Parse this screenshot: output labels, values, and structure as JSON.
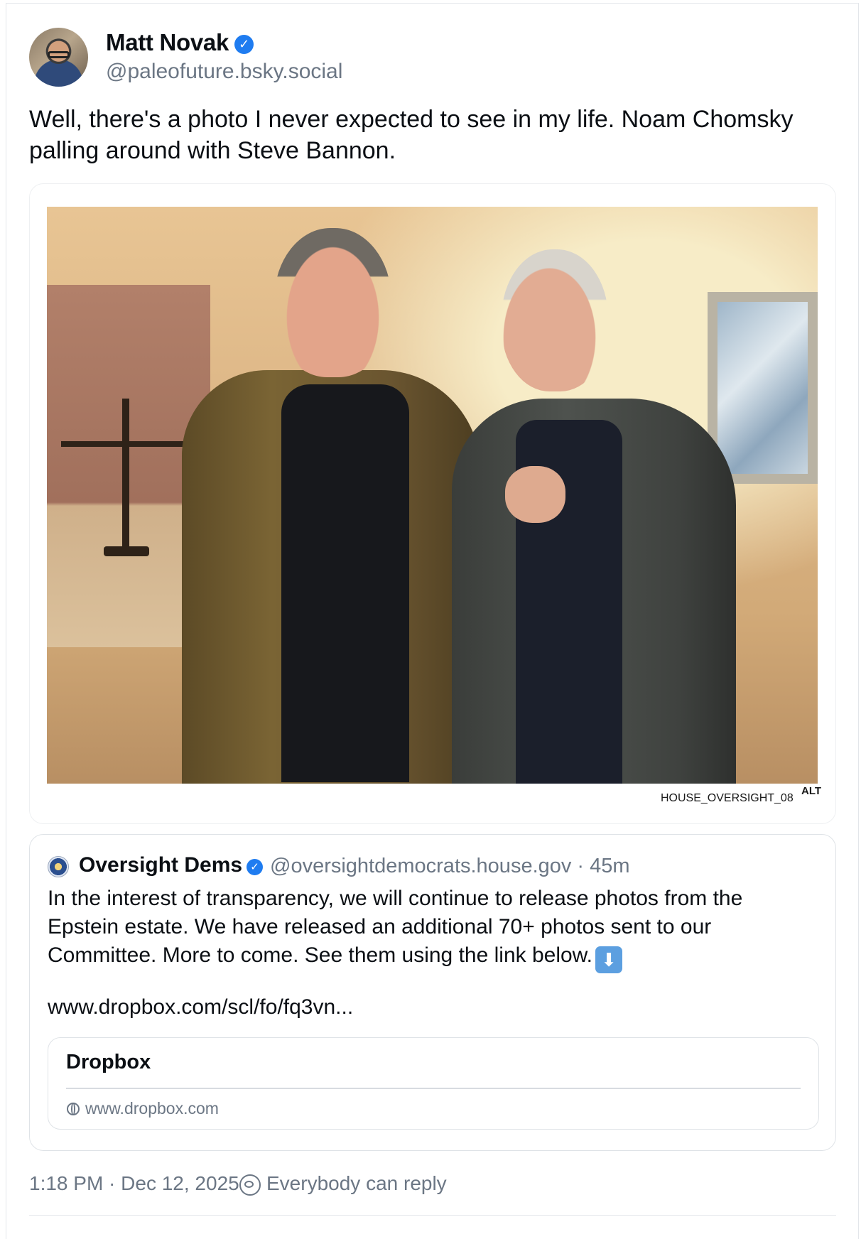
{
  "post": {
    "author": {
      "name": "Matt Novak",
      "handle": "@paleofuture.bsky.social",
      "verified_icon": "verified-badge-icon"
    },
    "text": "Well, there's a photo I never expected to see in my life. Noam Chomsky palling around with Steve Bannon.",
    "media": {
      "caption": "HOUSE_OVERSIGHT_08",
      "alt_badge": "ALT"
    },
    "quote": {
      "author_name": "Oversight Dems",
      "meta": "@oversightdemocrats.house.gov · 45m",
      "text": "In the interest of transparency, we will continue to release photos from the Epstein estate. We have released an additional 70+ photos sent to our Committee. More to come. See them using the link below.",
      "emoji": "⬇",
      "link_text": "www.dropbox.com/scl/fo/fq3vn...",
      "link_card": {
        "title": "Dropbox",
        "domain": "www.dropbox.com"
      }
    },
    "footer": {
      "timestamp": "1:18 PM · Dec 12, 2025",
      "reply_setting": "Everybody can reply"
    }
  },
  "colors": {
    "accent": "#1f7cf0",
    "muted_text": "#6b7684",
    "border": "#dfe3e7"
  }
}
